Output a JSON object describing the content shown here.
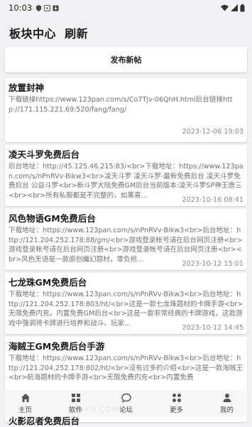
{
  "status_bar": {
    "time": "10:03"
  },
  "header": {
    "title": "板块中心  刷新"
  },
  "publish_button": {
    "label": "发布新帖"
  },
  "posts": [
    {
      "title": "放置封神",
      "body": "下载链接https://www.123pan.com/s/Co7Tjv-06QhH.html后台链接http://171.115.221.69:520/fang/fang/",
      "date": "2023-12-06 19:03"
    },
    {
      "title": "凌天斗罗免费后台",
      "body": "后台地址：http://45.125.46.215:83/<br>下载地址：https://www.123pan.com/s/nPnRVv-Bikw3<br>凌天斗罗 凌天斗罗-最新免费后台 凌天斗罗免费后台 公益斗罗<br>新斗罗大陆免费GM后台当前版本:凌天斗罗SP神王唐三<br><br>所有私服都是不完整的，如果喜...",
      "date": "2023-10-16 08:41"
    },
    {
      "title": "风色物语GM免费后台",
      "body": "下载地址：https://www.123pan.com/s/nPnRVv-Bikw3<br>后台地址：http://121.204.252.178:88/gm/<br>游戏登录帐号请在后台网页注册<br>游戏登录帐号请在后台网页注册<br>游戏登录帐号请在后台网页注册<br><br>风色无语是一款原创魔幻题材，零负担...",
      "date": "2023-10-12 15:01"
    },
    {
      "title": "七龙珠GM免费后台",
      "body": "下载地址：https://www.123pan.com/s/nPnRVv-Bikw3<br>后台地址：http://121.204.252.178:803/ht/<br>这是一款七龙珠题材的卡牌手游<br>无限免费内充，内置免费GM后台<br>这是一款非常经典的卡牌游戏，这款游戏中强调将卡牌进行培养和战斗。玩家...",
      "date": "2023-10-12 14:45"
    },
    {
      "title": "海贼王GM免费后台手游",
      "body": "下载地址：https://www.123pan.com/s/nPnRVv-Bikw3<br>后台地址：http://121.204.252.178:802/ht/<br>没有过多的介绍<br>这是一款海贼王<br>航海题材的卡牌手游<br>无限免费内充<br>内置免费",
      "date": ""
    }
  ],
  "peek_post_title": "火影忍者免费后台",
  "bottom_nav": [
    {
      "label": "主页",
      "icon": "home-icon"
    },
    {
      "label": "软件",
      "icon": "grid-icon"
    },
    {
      "label": "论坛",
      "icon": "chat-icon"
    },
    {
      "label": "更多",
      "icon": "apps-icon"
    },
    {
      "label": "我的",
      "icon": "person-icon"
    }
  ],
  "watermark": "NBYXH.COM",
  "colors": {
    "background": "#f1f1f3",
    "card": "#ffffff",
    "text_primary": "#1a1a1a",
    "text_secondary": "#707070"
  }
}
